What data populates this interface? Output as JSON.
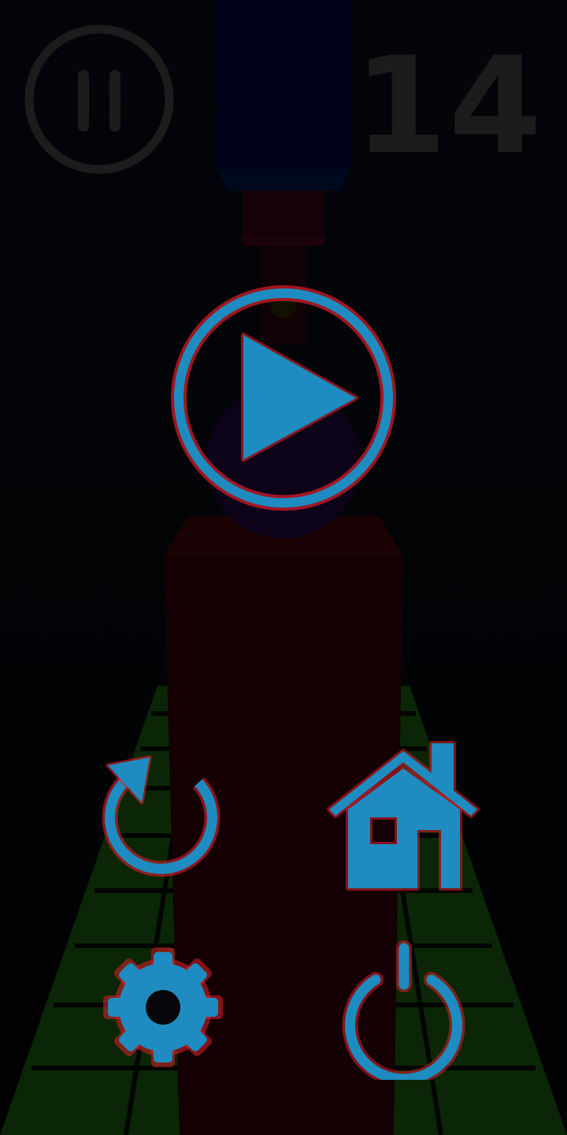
{
  "hud": {
    "score": "14"
  },
  "icons": {
    "pause": "pause-icon",
    "play": "play-icon",
    "restart": "restart-icon",
    "home": "home-icon",
    "settings": "gear-icon",
    "power": "power-icon"
  },
  "colors": {
    "icon_fill": "#1e8cc0",
    "icon_glow": "#e0202a",
    "hud_dim": "#1c1c1c",
    "background": "#020305",
    "track_green": "#0b2a06",
    "pillar": "#150003"
  }
}
